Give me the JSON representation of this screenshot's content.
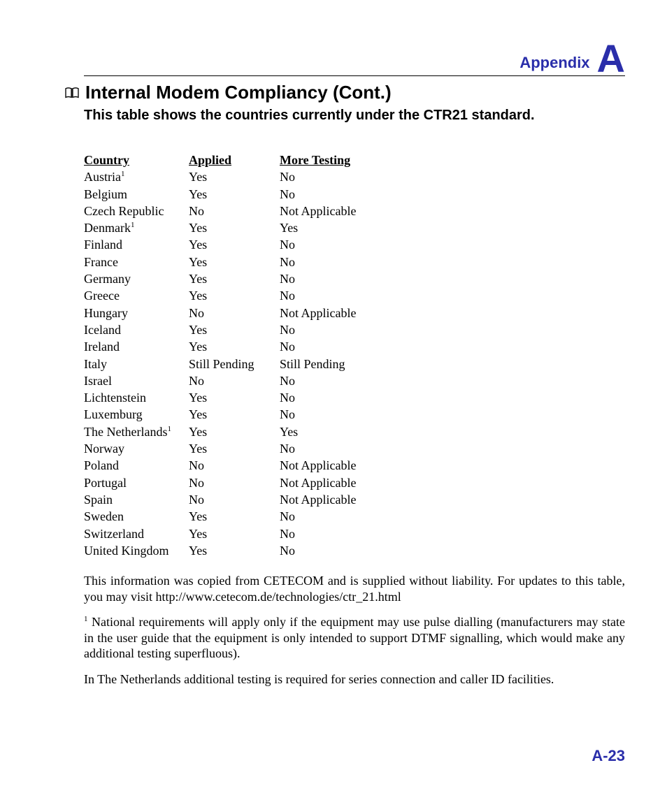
{
  "header": {
    "appendix_label": "Appendix",
    "appendix_letter": "A"
  },
  "title": "Internal Modem Compliancy (Cont.)",
  "subtitle": "This table shows the countries currently under the CTR21 standard.",
  "table": {
    "headers": {
      "country": "Country",
      "applied": "Applied",
      "more": "More Testing"
    },
    "rows": [
      {
        "country": "Austria",
        "sup": "1",
        "applied": "Yes",
        "more": "No"
      },
      {
        "country": "Belgium",
        "applied": "Yes",
        "more": "No"
      },
      {
        "country": "Czech Republic",
        "applied": "No",
        "more": "Not Applicable"
      },
      {
        "country": "Denmark",
        "sup": "1",
        "applied": "Yes",
        "more": "Yes"
      },
      {
        "country": "Finland",
        "applied": "Yes",
        "more": "No"
      },
      {
        "country": "France",
        "applied": "Yes",
        "more": "No"
      },
      {
        "country": "Germany",
        "applied": "Yes",
        "more": "No"
      },
      {
        "country": "Greece",
        "applied": "Yes",
        "more": "No"
      },
      {
        "country": "Hungary",
        "applied": "No",
        "more": "Not Applicable"
      },
      {
        "country": "Iceland",
        "applied": "Yes",
        "more": "No"
      },
      {
        "country": "Ireland",
        "applied": "Yes",
        "more": "No"
      },
      {
        "country": "Italy",
        "applied": "Still Pending",
        "more": "Still Pending"
      },
      {
        "country": "Israel",
        "applied": "No",
        "more": "No"
      },
      {
        "country": "Lichtenstein",
        "applied": "Yes",
        "more": "No"
      },
      {
        "country": "Luxemburg",
        "applied": "Yes",
        "more": "No"
      },
      {
        "country": "The Netherlands",
        "sup": "1",
        "applied": "Yes",
        "more": "Yes"
      },
      {
        "country": "Norway",
        "applied": "Yes",
        "more": "No"
      },
      {
        "country": "Poland",
        "applied": "No",
        "more": "Not Applicable"
      },
      {
        "country": "Portugal",
        "applied": "No",
        "more": "Not Applicable"
      },
      {
        "country": "Spain",
        "applied": "No",
        "more": "Not Applicable"
      },
      {
        "country": "Sweden",
        "applied": "Yes",
        "more": "No"
      },
      {
        "country": "Switzerland",
        "applied": "Yes",
        "more": "No"
      },
      {
        "country": "United Kingdom",
        "applied": "Yes",
        "more": "No"
      }
    ]
  },
  "paragraphs": {
    "p1": "This information was copied from CETECOM and is supplied without liability. For updates to this table, you may visit http://www.cetecom.de/technologies/ctr_21.html",
    "p2_sup": "1",
    "p2": " National requirements will apply only if the equipment may use pulse dialling (manufacturers may state in the user guide that the equipment is only intended to support DTMF signalling, which would make any additional testing superfluous).",
    "p3": "In The Netherlands additional testing is required for series connection and caller ID facilities."
  },
  "page_number": "A-23"
}
